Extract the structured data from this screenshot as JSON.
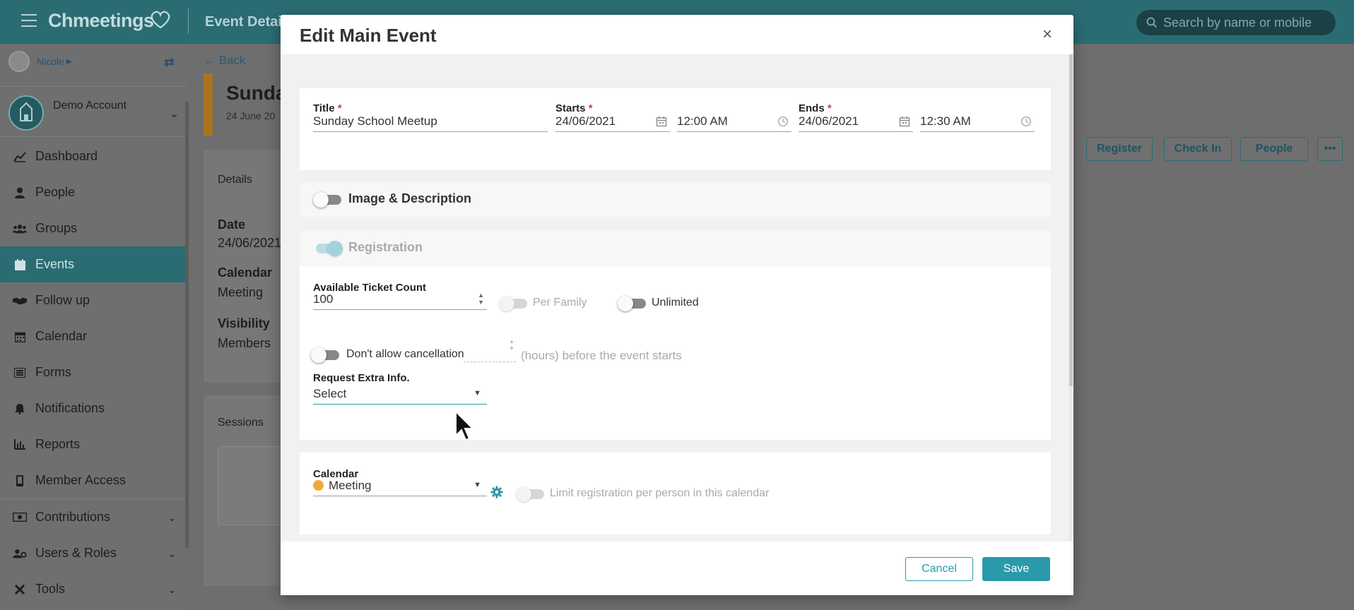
{
  "app": {
    "logo": "Chmeetings",
    "page_title": "Event Details",
    "search_placeholder": "Search by name or mobile"
  },
  "sidebar": {
    "user": "Nicole",
    "account": "Demo Account",
    "items": [
      {
        "label": "Dashboard",
        "icon": "chart-line-icon"
      },
      {
        "label": "People",
        "icon": "person-icon"
      },
      {
        "label": "Groups",
        "icon": "users-icon"
      },
      {
        "label": "Events",
        "icon": "calendar-icon",
        "active": true
      },
      {
        "label": "Follow up",
        "icon": "handshake-icon"
      },
      {
        "label": "Calendar",
        "icon": "calendar-grid-icon"
      },
      {
        "label": "Forms",
        "icon": "list-icon"
      },
      {
        "label": "Notifications",
        "icon": "bell-icon"
      },
      {
        "label": "Reports",
        "icon": "bar-chart-icon"
      },
      {
        "label": "Member Access",
        "icon": "mobile-icon"
      },
      {
        "label": "Contributions",
        "icon": "money-icon",
        "expandable": true
      },
      {
        "label": "Users & Roles",
        "icon": "users-cog-icon",
        "expandable": true
      },
      {
        "label": "Tools",
        "icon": "tools-icon",
        "expandable": true
      }
    ]
  },
  "main": {
    "back": "Back",
    "event_name": "Sunda",
    "event_date": "24 June 20",
    "details_card": {
      "title": "Details",
      "date_label": "Date",
      "date_value": "24/06/2021",
      "calendar_label": "Calendar",
      "calendar_value": "Meeting",
      "visibility_label": "Visibility",
      "visibility_value": "Members"
    },
    "sessions_title": "Sessions",
    "actions": [
      "Register",
      "Check In",
      "People",
      "•••"
    ]
  },
  "modal": {
    "title": "Edit Main Event",
    "close": "×",
    "title_field": {
      "label": "Title",
      "value": "Sunday School Meetup"
    },
    "starts": {
      "label": "Starts",
      "date": "24/06/2021",
      "time": "12:00 AM"
    },
    "ends": {
      "label": "Ends",
      "date": "24/06/2021",
      "time": "12:30 AM"
    },
    "image_section": {
      "label": "Image & Description",
      "enabled": false
    },
    "registration": {
      "label": "Registration",
      "enabled": true,
      "ticket_count_label": "Available Ticket Count",
      "ticket_count": "100",
      "per_family": "Per Family",
      "unlimited": "Unlimited",
      "cancellation": "Don't allow cancellation",
      "hours_text": "(hours) before the event starts",
      "extra_info_label": "Request Extra Info.",
      "extra_info_value": "Select"
    },
    "calendar": {
      "label": "Calendar",
      "value": "Meeting",
      "dot_color": "#f2a93b",
      "limit_text": "Limit registration per person in this calendar"
    },
    "cancel": "Cancel",
    "save": "Save",
    "accent": "#2a9aab"
  }
}
